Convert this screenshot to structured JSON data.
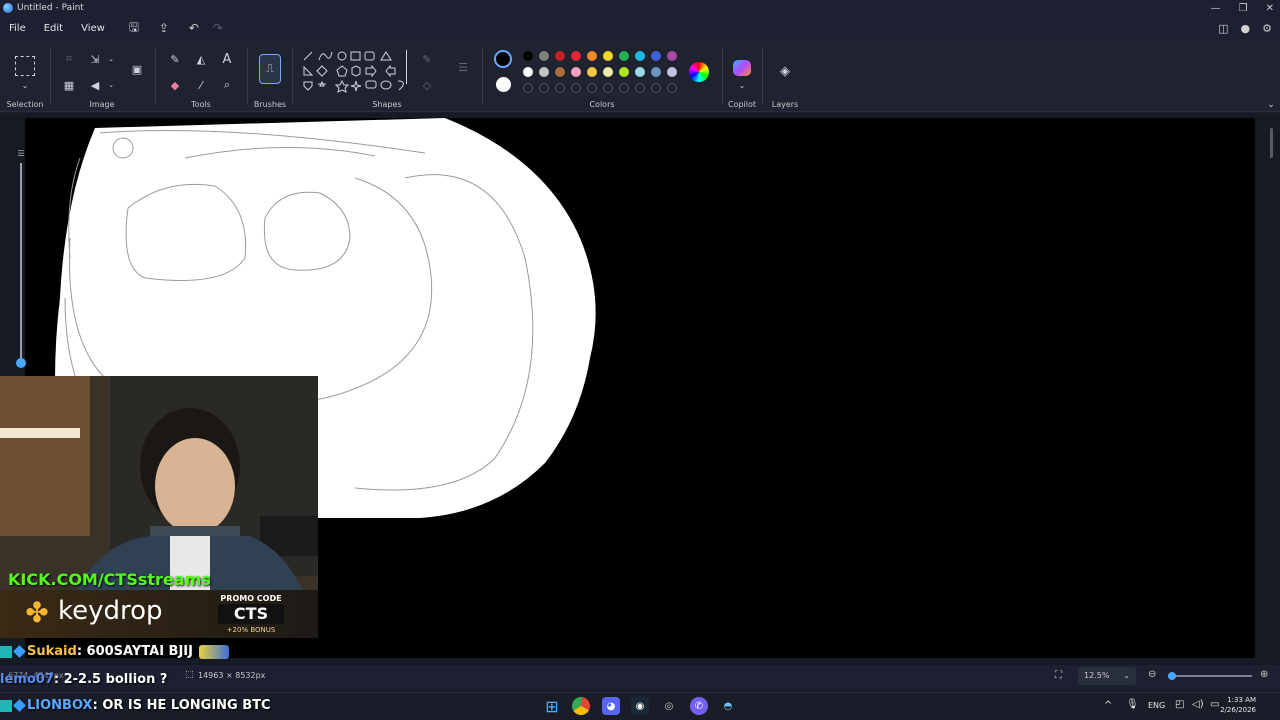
{
  "window": {
    "title": "Untitled - Paint"
  },
  "menu": {
    "file": "File",
    "edit": "Edit",
    "view": "View"
  },
  "ribbon": {
    "selection_label": "Selection",
    "image_label": "Image",
    "tools_label": "Tools",
    "brushes_label": "Brushes",
    "shapes_label": "Shapes",
    "colors_label": "Colors",
    "copilot_label": "Copilot",
    "layers_label": "Layers"
  },
  "colors": {
    "primary": "#000000",
    "secondary": "#ffffff",
    "palette_row1": [
      "#000000",
      "#7f7f7f",
      "#c6202e",
      "#e8232f",
      "#f08a24",
      "#f5d324",
      "#22b14c",
      "#22b5e8",
      "#3f63d8",
      "#a349a4"
    ],
    "palette_row2": [
      "#ffffff",
      "#c3c3c3",
      "#a86e3c",
      "#f3a0c0",
      "#f5c842",
      "#eee8aa",
      "#b5e61d",
      "#99d9ea",
      "#7092be",
      "#c8bfe7"
    ]
  },
  "status": {
    "cursor_pos": "6774, 4548px",
    "canvas_size": "14963 × 8532px",
    "zoom": "12.5%"
  },
  "overlay": {
    "kick_url": "KICK.COM/CTSstreams",
    "brand": "keydrop",
    "promo_label": "PROMO CODE",
    "promo_code": "CTS",
    "bonus": "+20% BONUS"
  },
  "chat": [
    {
      "user": "Sukaid",
      "message": "600SAYTAI BJIJ"
    },
    {
      "user": "lemo07",
      "message": "2-2.5 bollion ?"
    },
    {
      "user": "LIONBOX",
      "message": "OR IS HE LONGING BTC"
    }
  ],
  "taskbar": {
    "language": "ENG",
    "time": "1:33 AM",
    "date": "2/26/2026"
  }
}
